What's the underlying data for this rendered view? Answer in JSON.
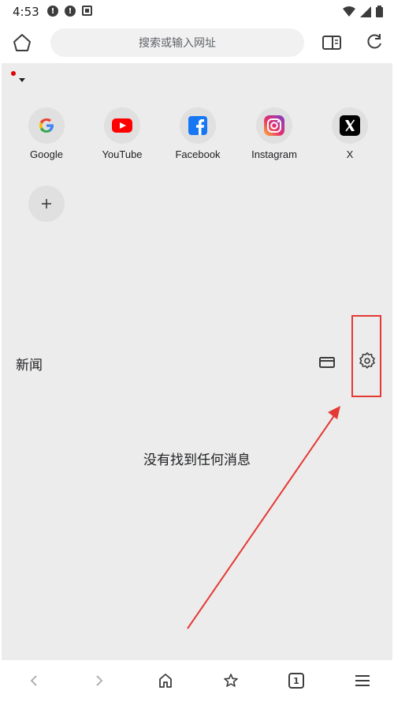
{
  "status_bar": {
    "time": "4:53"
  },
  "toolbar": {
    "url_placeholder": "搜索或输入网址"
  },
  "shortcuts": [
    {
      "label": "Google",
      "icon": "google-icon"
    },
    {
      "label": "YouTube",
      "icon": "youtube-icon"
    },
    {
      "label": "Facebook",
      "icon": "facebook-icon"
    },
    {
      "label": "Instagram",
      "icon": "instagram-icon"
    },
    {
      "label": "X",
      "icon": "x-icon"
    }
  ],
  "news": {
    "title": "新闻",
    "empty_message": "没有找到任何消息"
  },
  "bottom_nav": {
    "tab_count": "1"
  },
  "colors": {
    "highlight": "#e53935",
    "content_bg": "#ececec",
    "youtube": "#ff0000",
    "facebook": "#1877f2"
  }
}
